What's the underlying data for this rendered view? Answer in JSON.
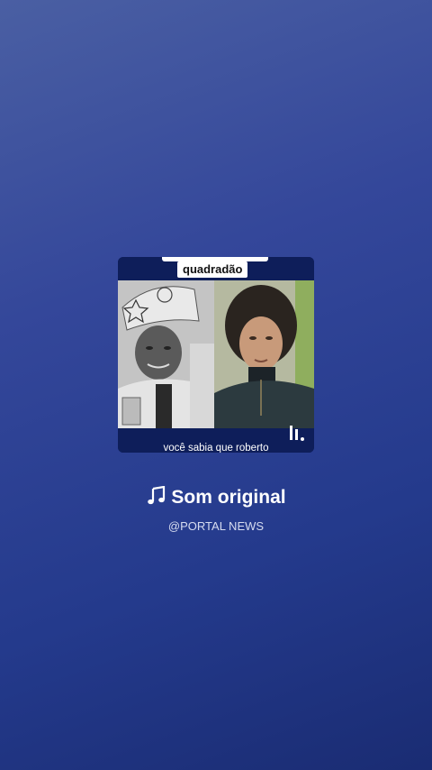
{
  "thumbnail": {
    "caption_top": "quadradão",
    "caption_bottom": "você sabia que roberto",
    "logo_icon": "pause-bars-logo-icon"
  },
  "sound": {
    "title": "Som original",
    "note_icon": "music-note-icon",
    "author": "@PORTAL NEWS"
  },
  "colors": {
    "background_top": "#4a5fa3",
    "background_bottom": "#1a2c73",
    "card_dark": "#0e1e5a"
  }
}
